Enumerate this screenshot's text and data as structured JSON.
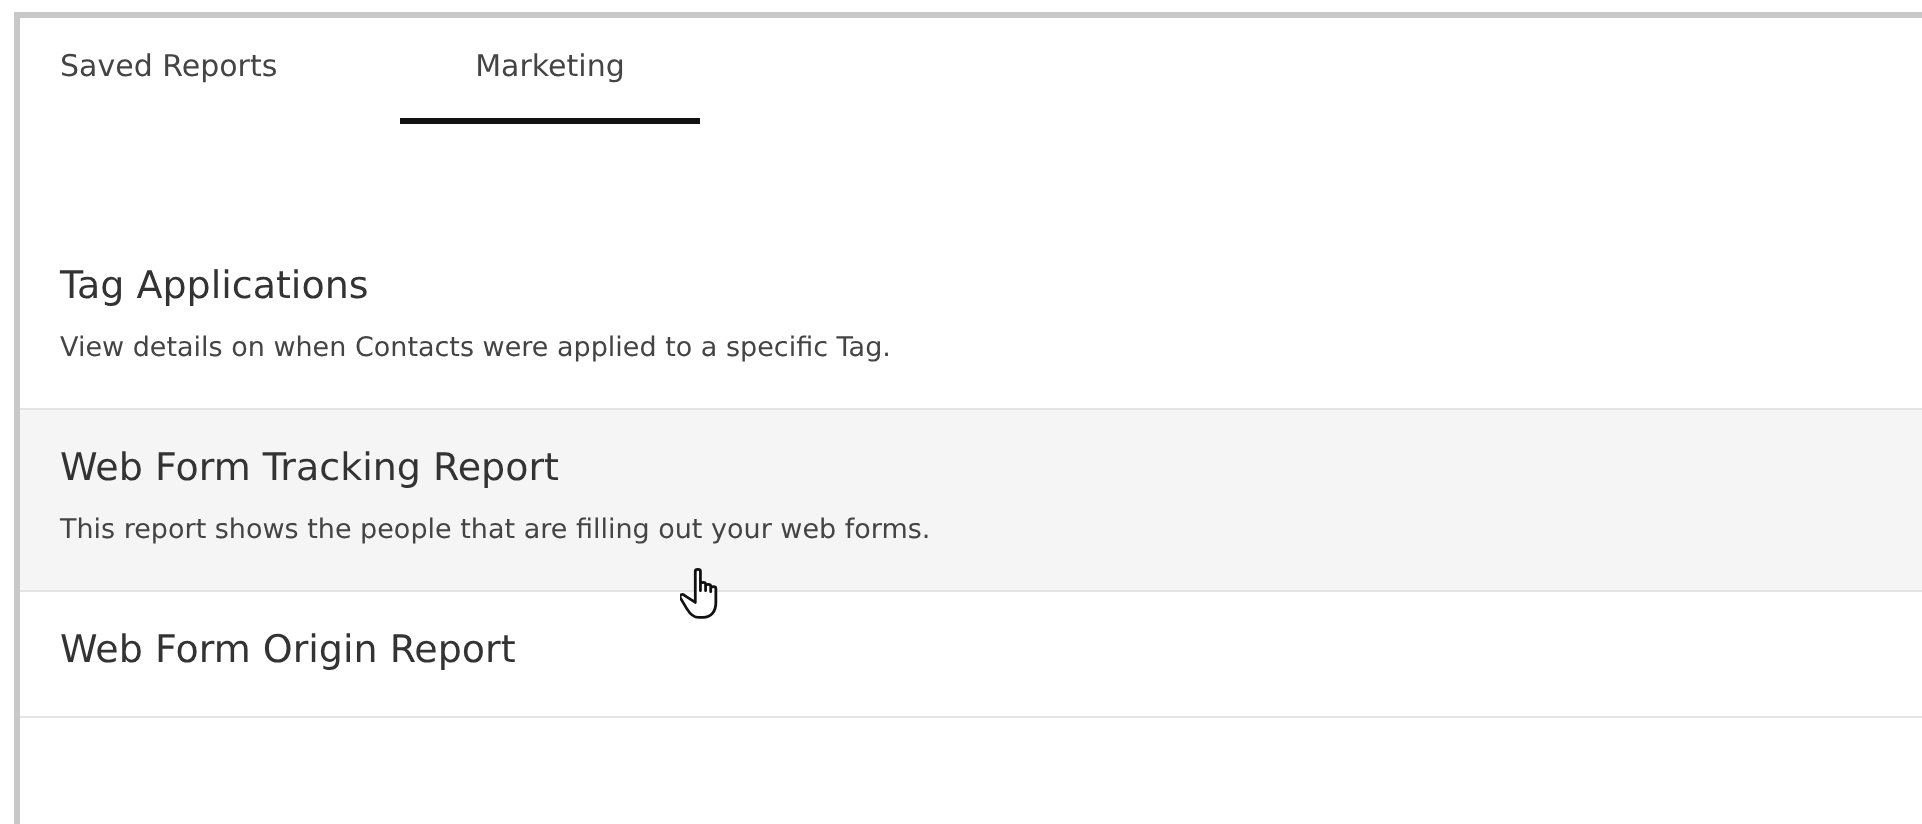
{
  "tabs": [
    {
      "label": "Saved Reports",
      "selected": false
    },
    {
      "label": "Marketing",
      "selected": true
    }
  ],
  "reports": [
    {
      "title": "Tag Applications",
      "description": "View details on when Contacts were applied to a specific Tag.",
      "hovered": false
    },
    {
      "title": "Web Form Tracking Report",
      "description": "This report shows the people that are filling out your web forms.",
      "hovered": true
    },
    {
      "title": "Web Form Origin Report",
      "hovered": false
    }
  ]
}
